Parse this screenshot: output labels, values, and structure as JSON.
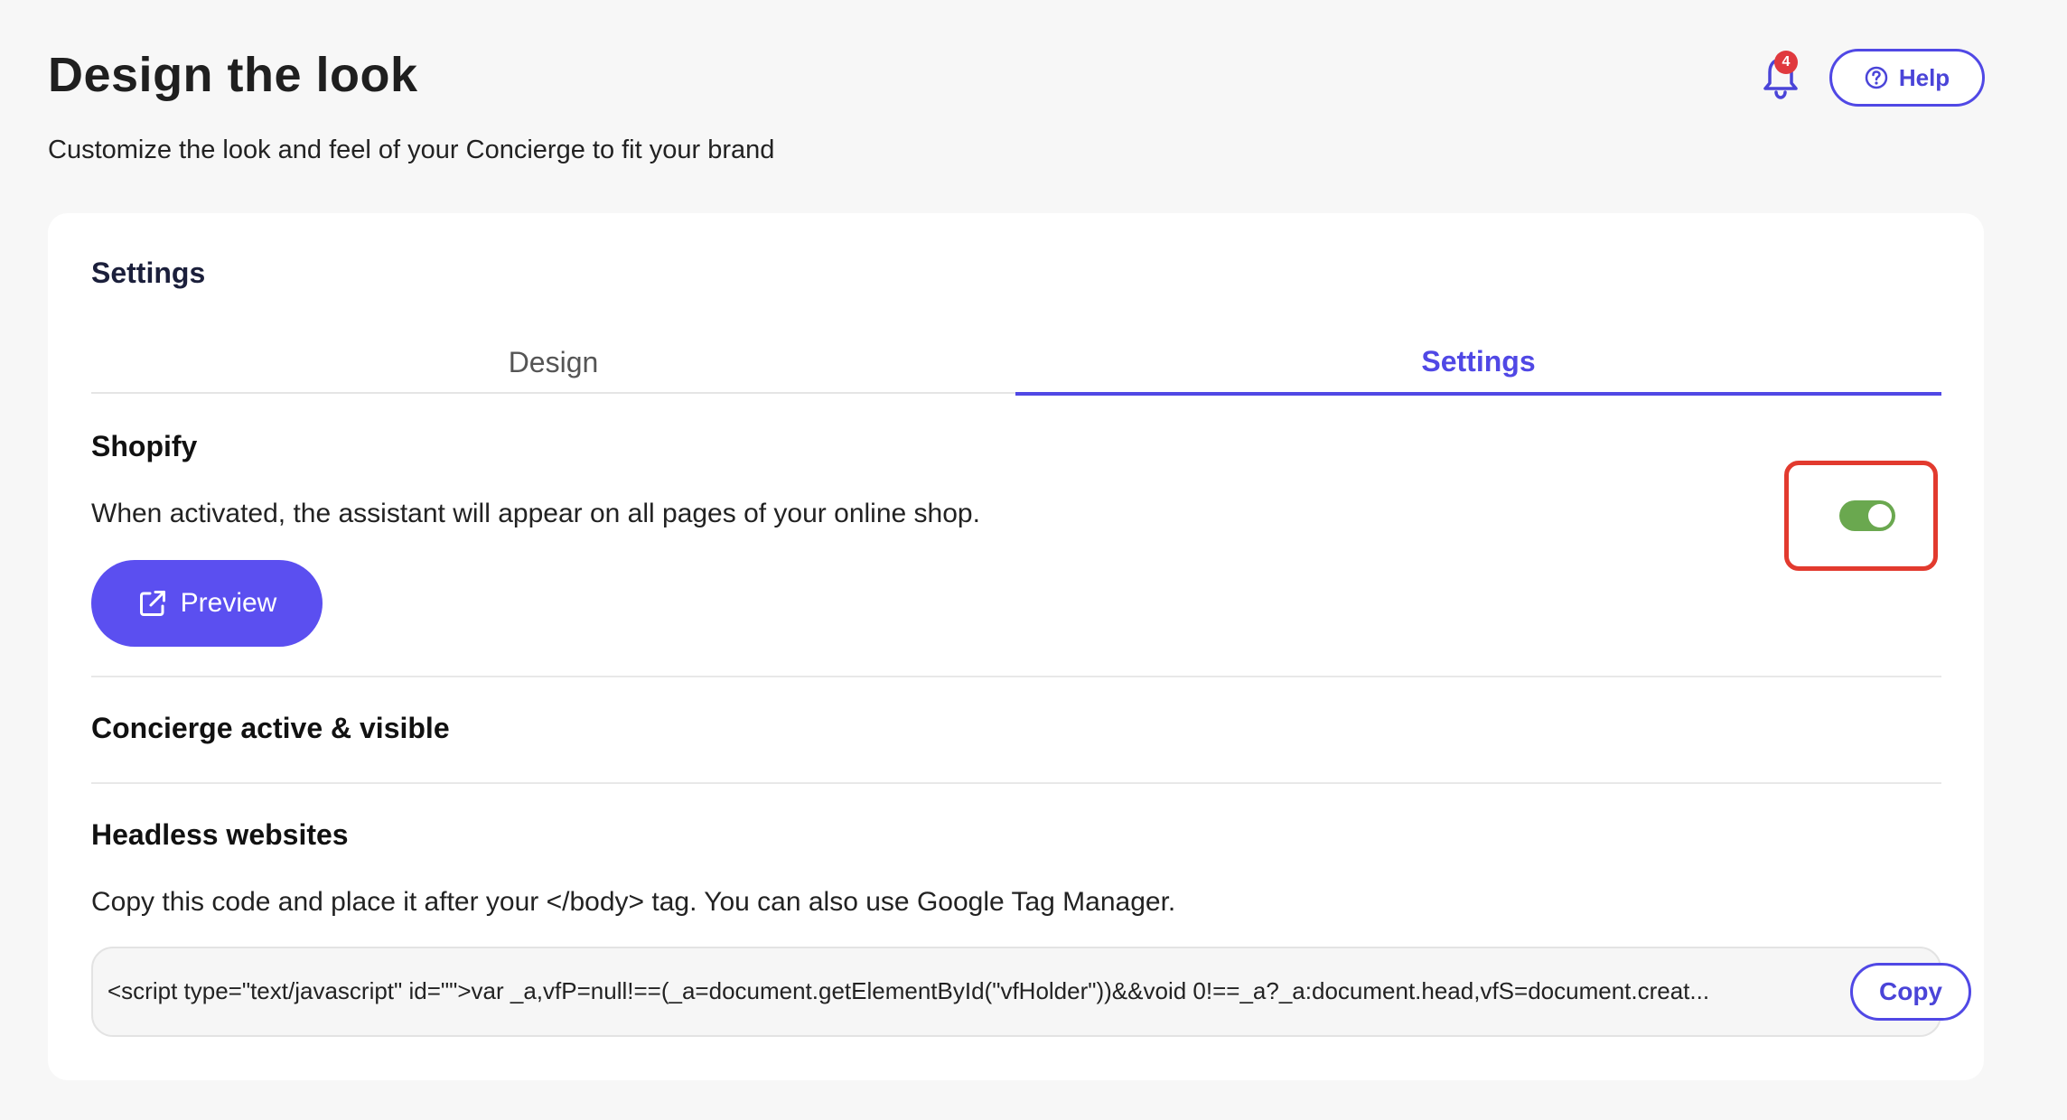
{
  "header": {
    "title": "Design the look",
    "subtitle": "Customize the look and feel of your Concierge to fit your brand",
    "notifications_count": "4",
    "help_label": "Help"
  },
  "card": {
    "title": "Settings",
    "tabs": [
      {
        "label": "Design",
        "active": false
      },
      {
        "label": "Settings",
        "active": true
      }
    ],
    "shopify": {
      "title": "Shopify",
      "description": "When activated, the assistant will appear on all pages of your online shop.",
      "preview_label": "Preview"
    },
    "concierge": {
      "label": "Concierge active & visible",
      "enabled": true
    },
    "headless": {
      "title": "Headless websites",
      "description": "Copy this code and place it after your </body> tag. You can also use Google Tag Manager.",
      "code": "<script type=\"text/javascript\" id=\"\">var _a,vfP=null!==(_a=document.getElementById(\"vfHolder\"))&&void 0!==_a?_a:document.head,vfS=document.creat...",
      "copy_label": "Copy"
    }
  },
  "colors": {
    "accent": "#5048e5",
    "toggle_on": "#6aa84f",
    "badge": "#e0393e",
    "highlight": "#e23a2e"
  },
  "icons": [
    "bell-icon",
    "help-circle-icon",
    "external-link-icon"
  ]
}
